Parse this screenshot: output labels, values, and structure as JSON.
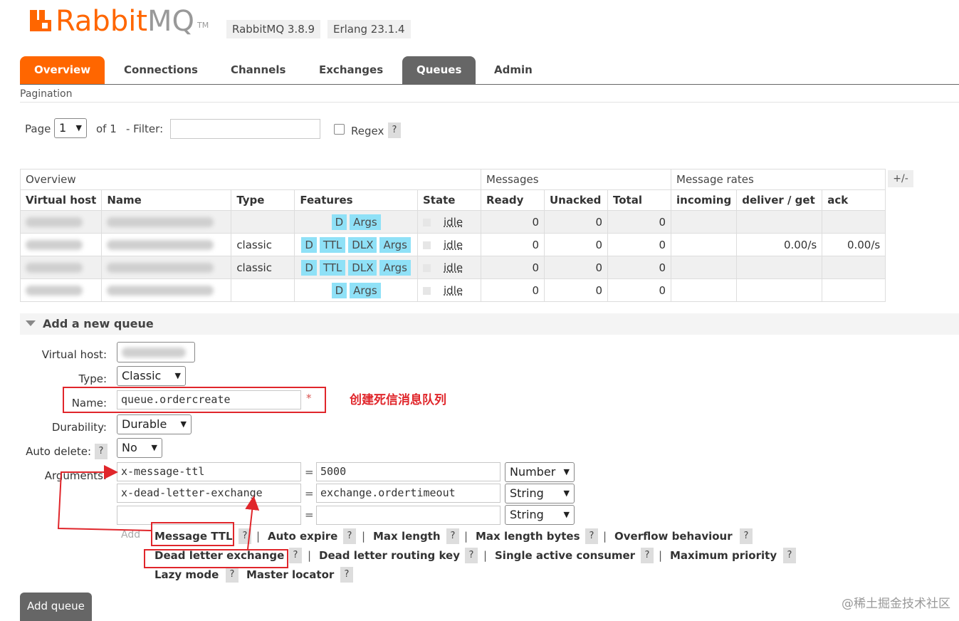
{
  "header": {
    "logo_rabbit": "Rabbit",
    "logo_mq": "MQ",
    "logo_tm": "TM",
    "version": "RabbitMQ 3.8.9",
    "erlang": "Erlang 23.1.4"
  },
  "tabs": [
    {
      "label": "Overview"
    },
    {
      "label": "Connections"
    },
    {
      "label": "Channels"
    },
    {
      "label": "Exchanges"
    },
    {
      "label": "Queues"
    },
    {
      "label": "Admin"
    }
  ],
  "pagination": {
    "title": "Pagination",
    "page_label": "Page",
    "page_value": "1",
    "of_label": "of 1",
    "filter_label": "- Filter:",
    "filter_value": "",
    "regex_label": "Regex",
    "help": "?"
  },
  "table": {
    "group_overview": "Overview",
    "group_messages": "Messages",
    "group_rates": "Message rates",
    "toggle": "+/-",
    "columns": [
      "Virtual host",
      "Name",
      "Type",
      "Features",
      "State",
      "Ready",
      "Unacked",
      "Total",
      "incoming",
      "deliver / get",
      "ack"
    ],
    "rows": [
      {
        "type": "",
        "features": [
          "D",
          "Args"
        ],
        "state": "idle",
        "ready": "0",
        "unacked": "0",
        "total": "0",
        "incoming": "",
        "deliver": "",
        "ack": ""
      },
      {
        "type": "classic",
        "features": [
          "D",
          "TTL",
          "DLX",
          "Args"
        ],
        "state": "idle",
        "ready": "0",
        "unacked": "0",
        "total": "0",
        "incoming": "",
        "deliver": "0.00/s",
        "ack": "0.00/s"
      },
      {
        "type": "classic",
        "features": [
          "D",
          "TTL",
          "DLX",
          "Args"
        ],
        "state": "idle",
        "ready": "0",
        "unacked": "0",
        "total": "0",
        "incoming": "",
        "deliver": "",
        "ack": ""
      },
      {
        "type": "",
        "features": [
          "D",
          "Args"
        ],
        "state": "idle",
        "ready": "0",
        "unacked": "0",
        "total": "0",
        "incoming": "",
        "deliver": "",
        "ack": ""
      }
    ]
  },
  "add_queue": {
    "section_title": "Add a new queue",
    "virtual_host_label": "Virtual host:",
    "type_label": "Type:",
    "type_value": "Classic",
    "name_label": "Name:",
    "name_value": "queue.ordercreate",
    "required": "*",
    "annotation": "创建死信消息队列",
    "durability_label": "Durability:",
    "durability_value": "Durable",
    "auto_delete_label": "Auto delete:",
    "auto_delete_value": "No",
    "arguments_label": "Arguments:",
    "arguments": [
      {
        "key": "x-message-ttl",
        "value": "5000",
        "type": "Number"
      },
      {
        "key": "x-dead-letter-exchange",
        "value": "exchange.ordertimeout",
        "type": "String"
      },
      {
        "key": "",
        "value": "",
        "type": "String"
      }
    ],
    "eq": "=",
    "add_label": "Add",
    "shortcuts": [
      "Message TTL",
      "Auto expire",
      "Max length",
      "Max length bytes",
      "Overflow behaviour",
      "Dead letter exchange",
      "Dead letter routing key",
      "Single active consumer",
      "Maximum priority",
      "Lazy mode",
      "Master locator"
    ],
    "sep": "|",
    "help": "?",
    "submit": "Add queue"
  },
  "watermark": "@稀土掘金技术社区",
  "colors": {
    "brand_orange": "#ff6600",
    "active_tab_grey": "#666666",
    "feature_pill": "#8fe1f7",
    "annotation_red": "#e0262b"
  }
}
